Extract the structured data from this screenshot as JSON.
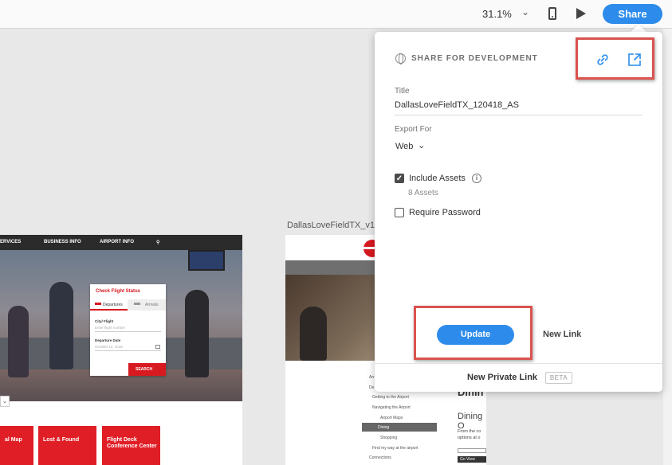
{
  "toolbar": {
    "zoom_level": "31.1%",
    "share_label": "Share",
    "icons": [
      "chevron-down-icon",
      "mobile-device-icon",
      "play-icon"
    ]
  },
  "artboard1": {
    "nav": [
      "ERVICES",
      "BUSINESS INFO",
      "AIRPORT INFO"
    ],
    "flight_card": {
      "title": "Check Flight Status",
      "tab_departures": "Departures",
      "tab_arrivals": "Arrivals",
      "city_label": "City/ Flight",
      "city_placeholder": "Enter flight number",
      "date_label": "Departure Date",
      "date_value": "October 12, 2018",
      "search_label": "SEARCH"
    },
    "tiles": [
      "al Map",
      "Lost & Found",
      "Flight Deck Conference Center"
    ]
  },
  "artboard2": {
    "label": "DallasLoveFieldTX_v1",
    "nav_items": [
      "Arr",
      "De",
      "Getting to the Airport",
      "Navigating the Airport",
      "Airport Maps",
      "Dining",
      "Shopping",
      "Find my way at the airport",
      "Connections"
    ],
    "heading": "Dinin",
    "subheading": "Dining O",
    "paragraph": [
      "From the co",
      "options at o"
    ],
    "button_label": "Go View"
  },
  "share_panel": {
    "heading": "SHARE FOR DEVELOPMENT",
    "title_label": "Title",
    "title_value": "DallasLoveFieldTX_120418_AS",
    "export_label": "Export For",
    "export_value": "Web",
    "include_assets_label": "Include Assets",
    "include_assets_checked": true,
    "assets_count": "8 Assets",
    "require_password_label": "Require Password",
    "require_password_checked": false,
    "update_label": "Update",
    "new_link_label": "New Link",
    "private_link_label": "New Private Link",
    "beta_label": "BETA",
    "accent_color": "#2d8ceb",
    "highlight_color": "#d9534f"
  }
}
